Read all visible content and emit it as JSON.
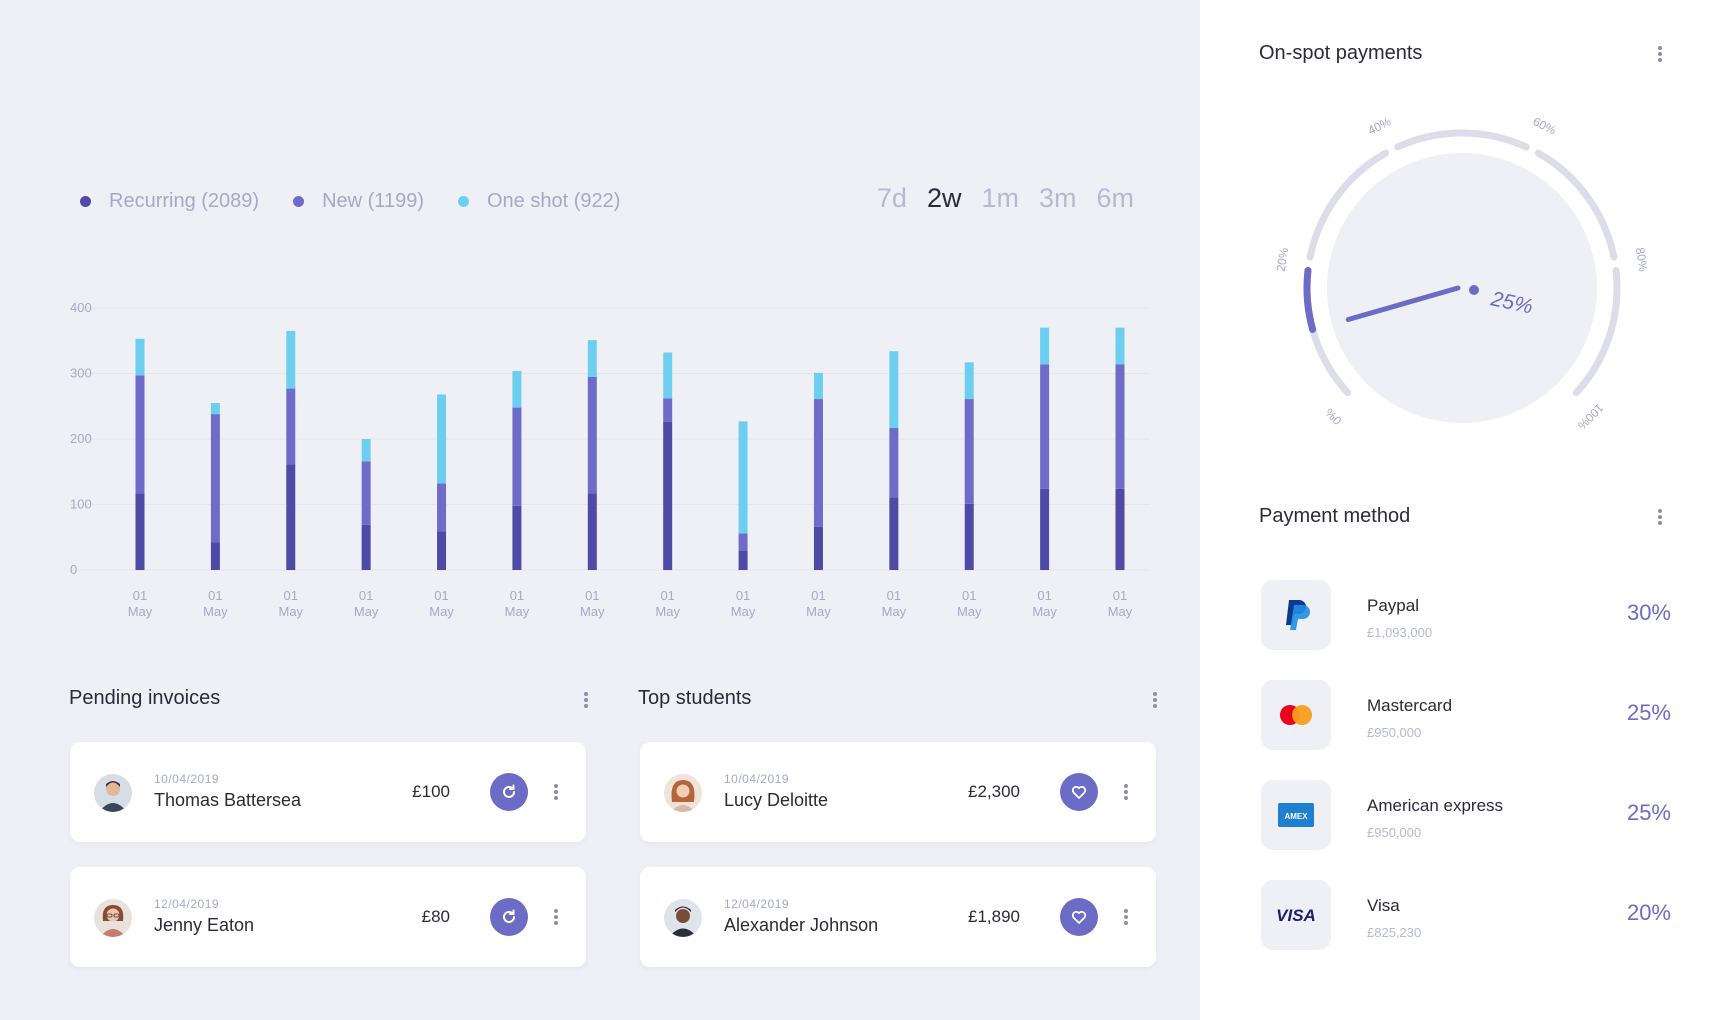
{
  "colors": {
    "recurring": "#4e4aa6",
    "new": "#6f6cc9",
    "one_shot": "#6dcff0",
    "accent": "#6c6bc6",
    "track": "#dcdde8"
  },
  "legend": [
    {
      "label": "Recurring (2089)",
      "color": "#4e4aa6"
    },
    {
      "label": "New (1199)",
      "color": "#6f6cc9"
    },
    {
      "label": "One shot (922)",
      "color": "#6dcff0"
    }
  ],
  "ranges": [
    "7d",
    "2w",
    "1m",
    "3m",
    "6m"
  ],
  "active_range": "2w",
  "chart_data": {
    "type": "bar",
    "stacked": true,
    "ylim": [
      0,
      400
    ],
    "yticks": [
      0,
      100,
      200,
      300,
      400
    ],
    "categories": [
      "01\nMay",
      "01\nMay",
      "01\nMay",
      "01\nMay",
      "01\nMay",
      "01\nMay",
      "01\nMay",
      "01\nMay",
      "01\nMay",
      "01\nMay",
      "01\nMay",
      "01\nMay",
      "01\nMay",
      "01\nMay"
    ],
    "series": [
      {
        "name": "Recurring (2089)",
        "color": "#4e4aa6",
        "values": [
          117,
          42,
          161,
          69,
          59,
          98,
          117,
          226,
          29,
          66,
          111,
          101,
          124,
          124
        ]
      },
      {
        "name": "New (1199)",
        "color": "#6f6cc9",
        "values": [
          180,
          196,
          116,
          97,
          73,
          150,
          178,
          36,
          27,
          195,
          106,
          160,
          190,
          190
        ]
      },
      {
        "name": "One shot (922)",
        "color": "#6dcff0",
        "values": [
          56,
          17,
          88,
          34,
          136,
          56,
          56,
          70,
          171,
          40,
          117,
          56,
          56,
          56
        ]
      }
    ],
    "grid": true
  },
  "pending": {
    "title": "Pending invoices",
    "items": [
      {
        "date": "10/04/2019",
        "name": "Thomas Battersea",
        "amount": "£100"
      },
      {
        "date": "12/04/2019",
        "name": "Jenny Eaton",
        "amount": "£80"
      }
    ]
  },
  "students": {
    "title": "Top students",
    "items": [
      {
        "date": "10/04/2019",
        "name": "Lucy Deloitte",
        "amount": "£2,300"
      },
      {
        "date": "12/04/2019",
        "name": "Alexander Johnson",
        "amount": "£1,890"
      }
    ]
  },
  "onspot": {
    "title": "On-spot payments",
    "value": 25,
    "value_label": "25%",
    "ticks": [
      "0%",
      "20%",
      "40%",
      "60%",
      "80%",
      "100%"
    ]
  },
  "payment_method": {
    "title": "Payment method",
    "items": [
      {
        "name": "Paypal",
        "amount": "£1,093,000",
        "pct": "30%",
        "icon": "paypal-icon"
      },
      {
        "name": "Mastercard",
        "amount": "£950,000",
        "pct": "25%",
        "icon": "mastercard-icon"
      },
      {
        "name": "American express",
        "amount": "£950,000",
        "pct": "25%",
        "icon": "amex-icon",
        "icon_text": "AMEX"
      },
      {
        "name": "Visa",
        "amount": "£825,230",
        "pct": "20%",
        "icon": "visa-icon",
        "icon_text": "VISA"
      }
    ]
  }
}
